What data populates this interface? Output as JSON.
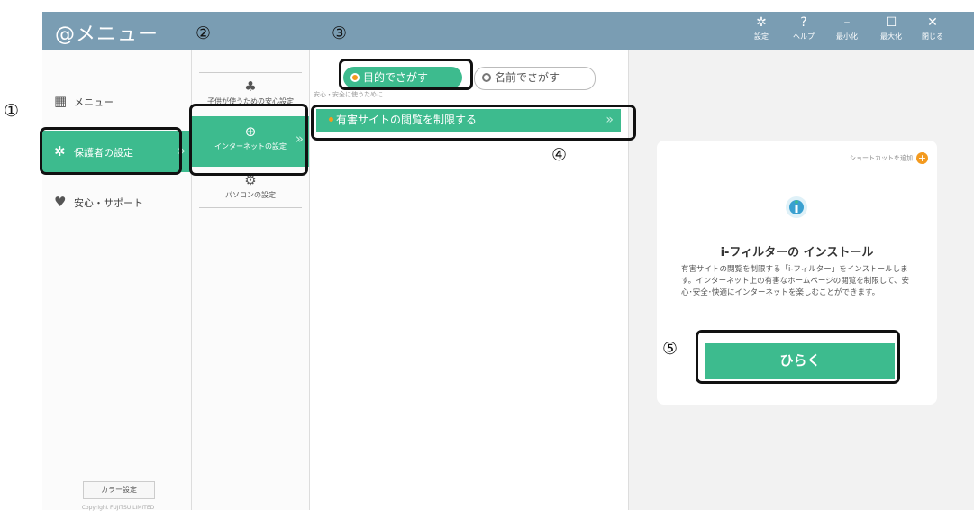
{
  "titlebar": {
    "app_name": "@メニュー",
    "buttons": [
      {
        "label": "設定",
        "icon": "gear-icon"
      },
      {
        "label": "ヘルプ",
        "icon": "help-icon"
      },
      {
        "label": "最小化",
        "icon": "minimize-icon"
      },
      {
        "label": "最大化",
        "icon": "maximize-icon"
      },
      {
        "label": "閉じる",
        "icon": "close-icon"
      }
    ]
  },
  "sidebar": {
    "items": [
      {
        "label": "メニュー",
        "icon": "grid-icon"
      },
      {
        "label": "保護者の設定",
        "icon": "gear-icon",
        "active": true
      },
      {
        "label": "安心・サポート",
        "icon": "heart-icon"
      }
    ],
    "color_button": "カラー設定",
    "copyright": "Copyright FUJITSU LIMITED"
  },
  "subnav": {
    "items": [
      {
        "label": "子供が使うための安心設定",
        "icon": "club-icon"
      },
      {
        "label": "インターネットの設定",
        "icon": "globe-gear-icon",
        "active": true
      },
      {
        "label": "パソコンの設定",
        "icon": "pc-gear-icon"
      }
    ]
  },
  "search": {
    "tabs": [
      {
        "label": "目的でさがす",
        "selected": true
      },
      {
        "label": "名前でさがす",
        "selected": false
      }
    ],
    "section_heading": "安心・安全に使うために",
    "items": [
      {
        "label": "有害サイトの閲覧を制限する",
        "selected": true
      }
    ]
  },
  "detail": {
    "shortcut_label": "ショートカットを追加",
    "title": "i-フィルターの インストール",
    "description": "有害サイトの閲覧を制限する「i-フィルター」をインストールします。インターネット上の有害なホームページの閲覧を制限して、安心･安全･快適にインターネットを楽しむことができます。",
    "open_button": "ひらく"
  },
  "annotations": [
    "①",
    "②",
    "③",
    "④",
    "⑤"
  ],
  "colors": {
    "accent": "#3dbb8e",
    "titlebar": "#7a9db3",
    "orange": "#f39a1f"
  }
}
